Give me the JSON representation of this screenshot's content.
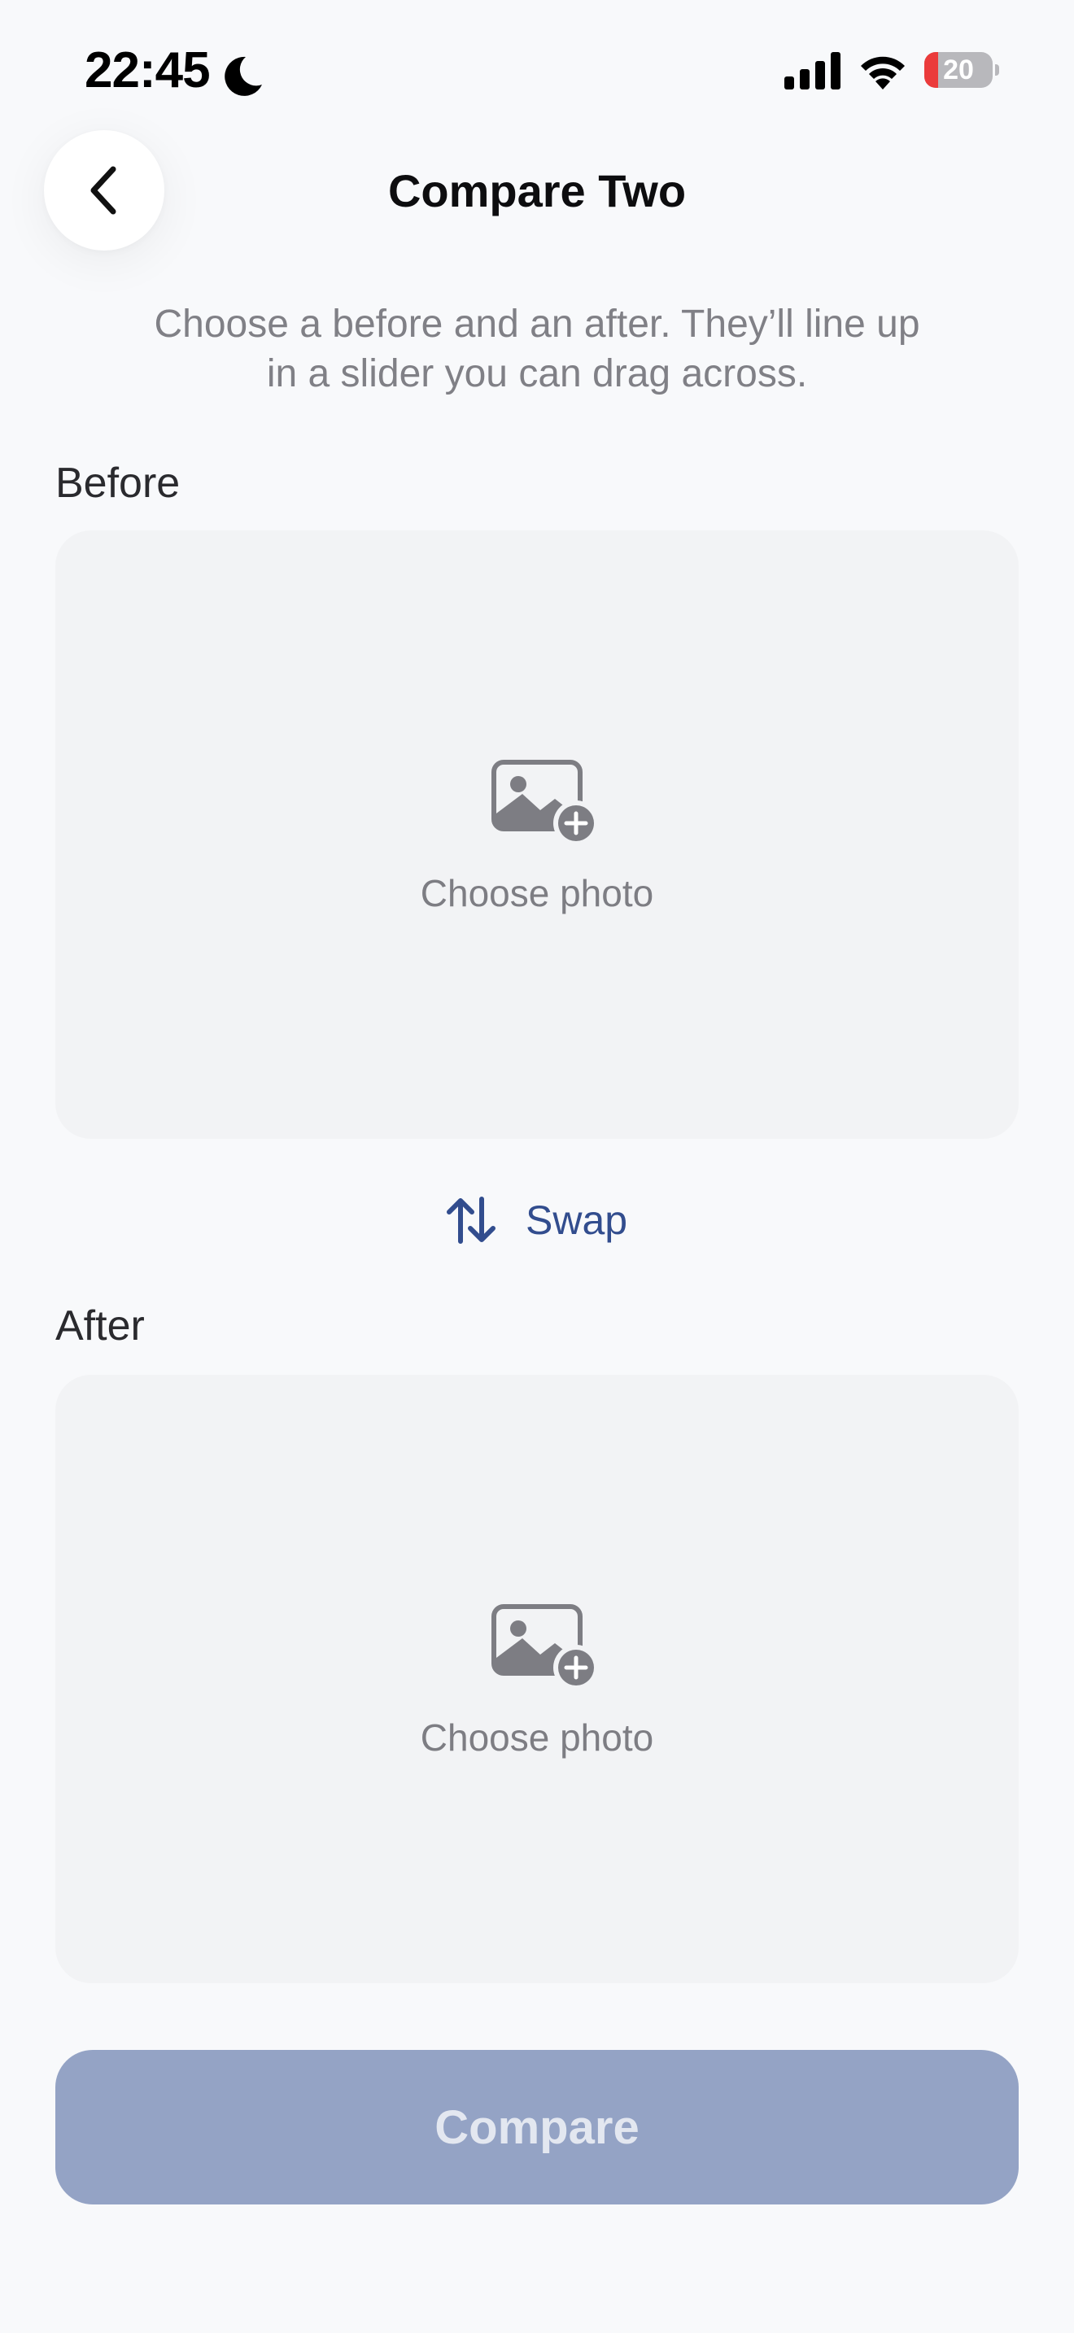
{
  "status_bar": {
    "time": "22:45",
    "battery_level": "20",
    "battery_fraction": 0.2,
    "moon_icon": "moon-icon",
    "signal_icon": "cellular-signal-icon",
    "wifi_icon": "wifi-icon"
  },
  "header": {
    "back_icon": "chevron-left-icon",
    "title": "Compare Two"
  },
  "subtitle_lines": [
    "Choose a before and an after. They’ll line up",
    "in a slider you can drag across."
  ],
  "before": {
    "label": "Before",
    "placeholder_icon": "add-photo-icon",
    "choose_label": "Choose photo"
  },
  "swap": {
    "icon": "swap-arrows-icon",
    "label": "Swap"
  },
  "after": {
    "label": "After",
    "placeholder_icon": "add-photo-icon",
    "choose_label": "Choose photo"
  },
  "compare_button": {
    "label": "Compare",
    "enabled": false
  },
  "colors": {
    "background": "#f8f9fb",
    "card": "#f2f3f5",
    "accent": "#324d8e",
    "button_disabled": "#94a3c5",
    "battery_low": "#eb3b3b"
  }
}
